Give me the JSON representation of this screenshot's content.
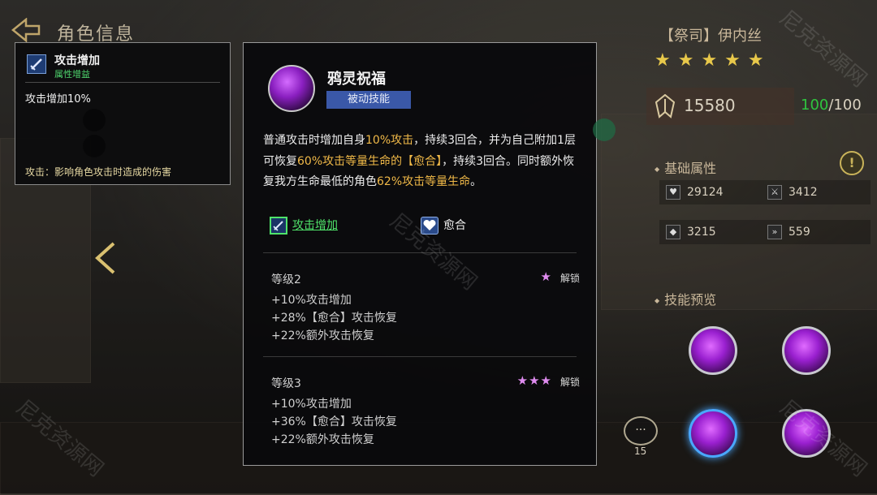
{
  "header": {
    "title": "角色信息"
  },
  "tooltip": {
    "name": "攻击增加",
    "type": "属性增益",
    "value": "攻击增加10%",
    "description": "攻击：影响角色攻击时造成的伤害"
  },
  "skill": {
    "name": "鸦灵祝福",
    "type": "被动技能",
    "desc_parts": [
      "普通攻击时增加自身",
      "10%攻击",
      "，持续3回合，并为自己附加1层可恢复",
      "60%攻击等量生命的【愈合】",
      "，持续3回合。同时额外恢复我方生命最低的角色",
      "62%攻击等量生命",
      "。"
    ],
    "tags": [
      "攻击增加",
      "愈合"
    ],
    "levels": [
      {
        "title": "等级2",
        "stars": "★",
        "unlock": "解锁",
        "lines": [
          "+10%攻击增加",
          "+28%【愈合】攻击恢复",
          "+22%额外攻击恢复"
        ]
      },
      {
        "title": "等级3",
        "stars": "★★★",
        "unlock": "解锁",
        "lines": [
          "+10%攻击增加",
          "+36%【愈合】攻击恢复",
          "+22%额外攻击恢复"
        ]
      }
    ]
  },
  "character": {
    "title": "【祭司】伊内丝",
    "stars": "★★★★★",
    "power": "15580",
    "energy_current": "100",
    "energy_max": "/100"
  },
  "sections": {
    "base_attrs": "基础属性",
    "skill_preview": "技能预览"
  },
  "attributes": [
    {
      "icon": "heart-icon",
      "value": "29124"
    },
    {
      "icon": "sword-icon",
      "value": "3412"
    },
    {
      "icon": "shield-icon",
      "value": "3215"
    },
    {
      "icon": "speed-icon",
      "value": "559"
    }
  ],
  "chat": {
    "count": "15"
  },
  "watermark": "尼克资源网",
  "colors": {
    "highlight": "#f0b948",
    "green": "#4fe36a",
    "skill_type_bg": "#3a58a8",
    "star": "#e8c84a"
  }
}
